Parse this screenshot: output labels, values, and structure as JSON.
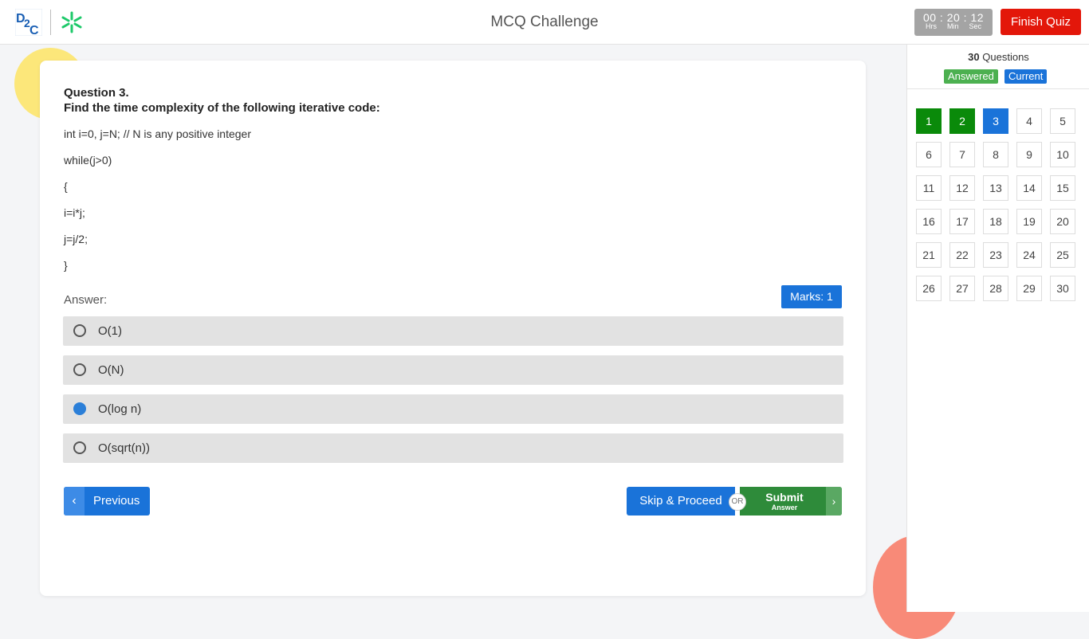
{
  "header": {
    "title": "MCQ Challenge",
    "timer": {
      "hrs": "00",
      "min": "20",
      "sec": "12",
      "hrs_label": "Hrs",
      "min_label": "Min",
      "sec_label": "Sec"
    },
    "finish_label": "Finish Quiz",
    "logo_text": "D2C"
  },
  "question": {
    "number": "Question 3.",
    "text": "Find the time complexity of the following iterative code:",
    "code": [
      "int i=0, j=N;  // N is any positive integer",
      "while(j>0)",
      "{",
      "i=i*j;",
      "j=j/2;",
      "}"
    ],
    "answer_label": "Answer:",
    "marks": "Marks: 1",
    "options": [
      {
        "label": "O(1)",
        "selected": false
      },
      {
        "label": "O(N)",
        "selected": false
      },
      {
        "label": "O(log n)",
        "selected": true
      },
      {
        "label": "O(sqrt(n))",
        "selected": false
      }
    ]
  },
  "footer": {
    "previous_label": "Previous",
    "skip_label": "Skip & Proceed",
    "or_label": "OR",
    "submit_label": "Submit",
    "submit_sub": "Answer"
  },
  "sidebar": {
    "count": "30",
    "count_suffix": "Questions",
    "legend_answered": "Answered",
    "legend_current": "Current",
    "questions": [
      {
        "n": "1",
        "state": "answered"
      },
      {
        "n": "2",
        "state": "answered"
      },
      {
        "n": "3",
        "state": "current"
      },
      {
        "n": "4",
        "state": "none"
      },
      {
        "n": "5",
        "state": "none"
      },
      {
        "n": "6",
        "state": "none"
      },
      {
        "n": "7",
        "state": "none"
      },
      {
        "n": "8",
        "state": "none"
      },
      {
        "n": "9",
        "state": "none"
      },
      {
        "n": "10",
        "state": "none"
      },
      {
        "n": "11",
        "state": "none"
      },
      {
        "n": "12",
        "state": "none"
      },
      {
        "n": "13",
        "state": "none"
      },
      {
        "n": "14",
        "state": "none"
      },
      {
        "n": "15",
        "state": "none"
      },
      {
        "n": "16",
        "state": "none"
      },
      {
        "n": "17",
        "state": "none"
      },
      {
        "n": "18",
        "state": "none"
      },
      {
        "n": "19",
        "state": "none"
      },
      {
        "n": "20",
        "state": "none"
      },
      {
        "n": "21",
        "state": "none"
      },
      {
        "n": "22",
        "state": "none"
      },
      {
        "n": "23",
        "state": "none"
      },
      {
        "n": "24",
        "state": "none"
      },
      {
        "n": "25",
        "state": "none"
      },
      {
        "n": "26",
        "state": "none"
      },
      {
        "n": "27",
        "state": "none"
      },
      {
        "n": "28",
        "state": "none"
      },
      {
        "n": "29",
        "state": "none"
      },
      {
        "n": "30",
        "state": "none"
      }
    ]
  },
  "colors": {
    "primary": "#1a73d9",
    "answered": "#0a8a0a",
    "danger": "#e3170a",
    "submit": "#2e8b3a"
  },
  "icons": {
    "previous": "chevron-left-icon",
    "submit": "chevron-right-icon",
    "logo_star": "asterisk-logo-icon"
  }
}
